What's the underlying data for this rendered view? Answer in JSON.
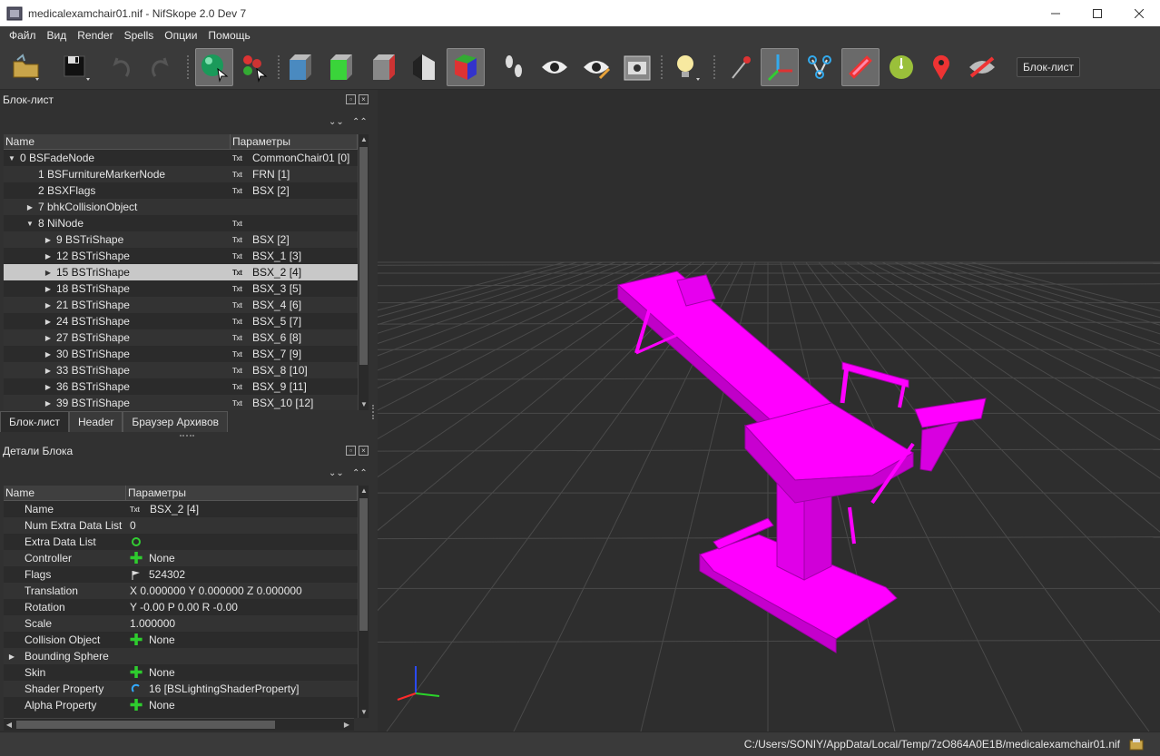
{
  "window": {
    "title": "medicalexamchair01.nif - NifSkope 2.0 Dev 7"
  },
  "menu": [
    "Файл",
    "Вид",
    "Render",
    "Spells",
    "Опции",
    "Помощь"
  ],
  "toolbar": {
    "blocklist_button": "Блок-лист"
  },
  "block_list": {
    "title": "Блок-лист",
    "col_name": "Name",
    "col_params": "Параметры",
    "rows": [
      {
        "arrow": "▼",
        "indent": 0,
        "name": "0 BSFadeNode",
        "txt": true,
        "param": "CommonChair01 [0]"
      },
      {
        "arrow": "",
        "indent": 1,
        "name": "1 BSFurnitureMarkerNode",
        "txt": true,
        "param": "FRN [1]"
      },
      {
        "arrow": "",
        "indent": 1,
        "name": "2 BSXFlags",
        "txt": true,
        "param": "BSX [2]"
      },
      {
        "arrow": "▶",
        "indent": 1,
        "name": "7 bhkCollisionObject",
        "txt": false,
        "param": ""
      },
      {
        "arrow": "▼",
        "indent": 1,
        "name": "8 NiNode",
        "txt": true,
        "param": ""
      },
      {
        "arrow": "▶",
        "indent": 2,
        "name": "9 BSTriShape",
        "txt": true,
        "param": "BSX [2]"
      },
      {
        "arrow": "▶",
        "indent": 2,
        "name": "12 BSTriShape",
        "txt": true,
        "param": "BSX_1 [3]"
      },
      {
        "arrow": "▶",
        "indent": 2,
        "name": "15 BSTriShape",
        "txt": true,
        "param": "BSX_2 [4]",
        "selected": true
      },
      {
        "arrow": "▶",
        "indent": 2,
        "name": "18 BSTriShape",
        "txt": true,
        "param": "BSX_3 [5]"
      },
      {
        "arrow": "▶",
        "indent": 2,
        "name": "21 BSTriShape",
        "txt": true,
        "param": "BSX_4 [6]"
      },
      {
        "arrow": "▶",
        "indent": 2,
        "name": "24 BSTriShape",
        "txt": true,
        "param": "BSX_5 [7]"
      },
      {
        "arrow": "▶",
        "indent": 2,
        "name": "27 BSTriShape",
        "txt": true,
        "param": "BSX_6 [8]"
      },
      {
        "arrow": "▶",
        "indent": 2,
        "name": "30 BSTriShape",
        "txt": true,
        "param": "BSX_7 [9]"
      },
      {
        "arrow": "▶",
        "indent": 2,
        "name": "33 BSTriShape",
        "txt": true,
        "param": "BSX_8 [10]"
      },
      {
        "arrow": "▶",
        "indent": 2,
        "name": "36 BSTriShape",
        "txt": true,
        "param": "BSX_9 [11]"
      },
      {
        "arrow": "▶",
        "indent": 2,
        "name": "39 BSTriShape",
        "txt": true,
        "param": "BSX_10 [12]"
      }
    ],
    "txt_label": "Txt"
  },
  "tabs": [
    "Блок-лист",
    "Header",
    "Браузер Архивов"
  ],
  "block_details": {
    "title": "Детали Блока",
    "col_name": "Name",
    "col_params": "Параметры",
    "rows": [
      {
        "arrow": "",
        "name": "Name",
        "icon": "txt",
        "value": "BSX_2 [4]"
      },
      {
        "arrow": "",
        "name": "Num Extra Data List",
        "icon": "",
        "value": "0"
      },
      {
        "arrow": "",
        "name": "Extra Data List",
        "icon": "refresh",
        "value": ""
      },
      {
        "arrow": "",
        "name": "Controller",
        "icon": "plus",
        "value": "None"
      },
      {
        "arrow": "",
        "name": "Flags",
        "icon": "flag",
        "value": "524302"
      },
      {
        "arrow": "",
        "name": "Translation",
        "icon": "",
        "value": "X 0.000000 Y 0.000000 Z 0.000000"
      },
      {
        "arrow": "",
        "name": "Rotation",
        "icon": "",
        "value": "Y -0.00 P 0.00 R -0.00"
      },
      {
        "arrow": "",
        "name": "Scale",
        "icon": "",
        "value": "1.000000"
      },
      {
        "arrow": "",
        "name": "Collision Object",
        "icon": "plus",
        "value": "None"
      },
      {
        "arrow": "▶",
        "name": "Bounding Sphere",
        "icon": "",
        "value": ""
      },
      {
        "arrow": "",
        "name": "Skin",
        "icon": "plus",
        "value": "None"
      },
      {
        "arrow": "",
        "name": "Shader Property",
        "icon": "link",
        "value": "16 [BSLightingShaderProperty]"
      },
      {
        "arrow": "",
        "name": "Alpha Property",
        "icon": "plus",
        "value": "None"
      }
    ]
  },
  "status": {
    "path": "C:/Users/SONIY/AppData/Local/Temp/7zO864A0E1B/medicalexamchair01.nif"
  },
  "colors": {
    "mesh": "#ff00ff",
    "background": "#2e2e2e",
    "grid": "#4a4a4a",
    "selection": "#c8c8c8"
  }
}
